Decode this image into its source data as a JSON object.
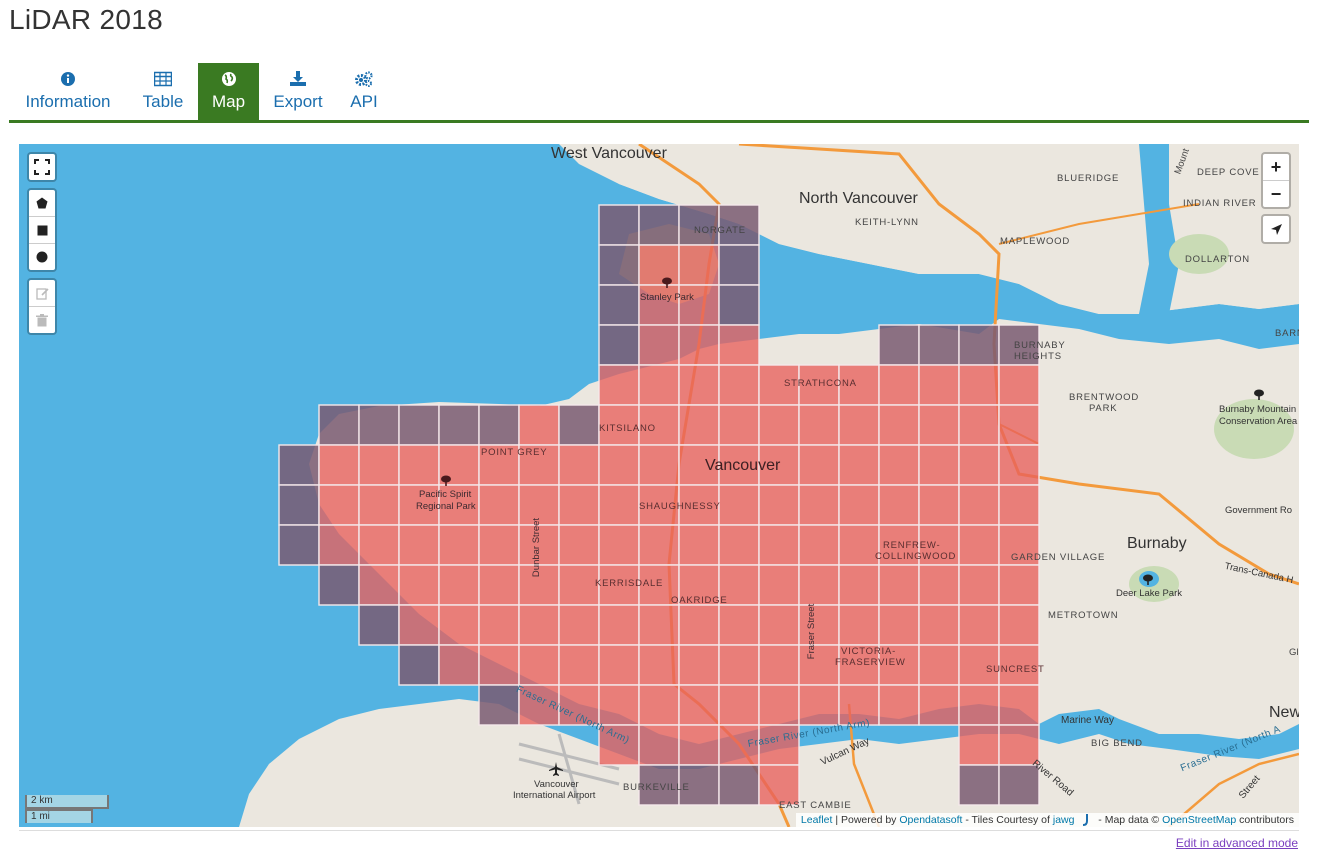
{
  "title": "LiDAR 2018",
  "tabs": [
    {
      "label": "Information",
      "icon": "info-icon"
    },
    {
      "label": "Table",
      "icon": "table-icon"
    },
    {
      "label": "Map",
      "icon": "globe-icon",
      "active": true
    },
    {
      "label": "Export",
      "icon": "download-icon"
    },
    {
      "label": "API",
      "icon": "gears-icon"
    }
  ],
  "colors": {
    "accent": "#3a7a22",
    "link": "#1b6eae",
    "water": "#53b3e2",
    "tile_fill": "#e8605c",
    "tile_water": "#7a5a72"
  },
  "map": {
    "place_labels": {
      "west_vancouver": "West Vancouver",
      "north_vancouver": "North Vancouver",
      "keith_lynn": "KEITH-LYNN",
      "norgate": "NORGATE",
      "blueridge": "BLUERIDGE",
      "deep_cove": "DEEP COVE",
      "indian_river": "INDIAN RIVER",
      "maplewood": "MAPLEWOOD",
      "dollarton": "DOLLARTON",
      "mount": "Mount",
      "stanley_park": "Stanley Park",
      "barnet": "BARNET",
      "burnaby_heights_1": "BURNABY",
      "burnaby_heights_2": "HEIGHTS",
      "strathcona": "STRATHCONA",
      "brentwood_1": "BRENTWOOD",
      "brentwood_2": "PARK",
      "burnaby_mountain_1": "Burnaby Mountain",
      "burnaby_mountain_2": "Conservation Area",
      "kitsilano": "KITSILANO",
      "point_grey": "POINT GREY",
      "vancouver": "Vancouver",
      "pacific_spirit_1": "Pacific Spirit",
      "pacific_spirit_2": "Regional Park",
      "shaughnessy": "SHAUGHNESSY",
      "government": "Government Ro",
      "dunbar": "Dunbar Street",
      "renfrew_1": "RENFREW-",
      "renfrew_2": "COLLINGWOOD",
      "burnaby": "Burnaby",
      "garden_village": "GARDEN VILLAGE",
      "kerrisdale": "KERRISDALE",
      "trans_canada": "Trans-Canada H",
      "deer_lake": "Deer Lake Park",
      "oakridge": "OAKRIDGE",
      "metrotown": "METROTOWN",
      "fraser_street": "Fraser Street",
      "victoria_1": "VICTORIA-",
      "victoria_2": "FRASERVIEW",
      "suncrest": "SUNCREST",
      "fraser_river_north": "Fraser River (North Arm)",
      "marine_way": "Marine Way",
      "new": "New",
      "big_bend": "BIG BEND",
      "fraser_river_2": "Fraser River (North A",
      "fraser_river_3": "Fraser River (North Arm)",
      "river_road": "River Road",
      "vulcan_way": "Vulcan Way",
      "vancouver_airport_1": "Vancouver",
      "vancouver_airport_2": "International Airport",
      "burkeville": "BURKEVILLE",
      "east_cambie": "EAST CAMBIE",
      "street": "Street",
      "gl": "Gl",
      "fraser_river_4": "Fraser River (N"
    },
    "scale": {
      "metric": "2 km",
      "imperial": "1 mi"
    },
    "zoom_in": "+",
    "zoom_out": "−",
    "attribution": {
      "leaflet": "Leaflet",
      "powered": " | Powered by ",
      "ods": "Opendatasoft",
      "tiles": " - Tiles Courtesy of ",
      "jawg": "jawg",
      "mapdata": " - Map data © ",
      "osm": "OpenStreetMap",
      "contrib": " contributors"
    }
  },
  "footer": {
    "advanced_link": "Edit in advanced mode"
  }
}
